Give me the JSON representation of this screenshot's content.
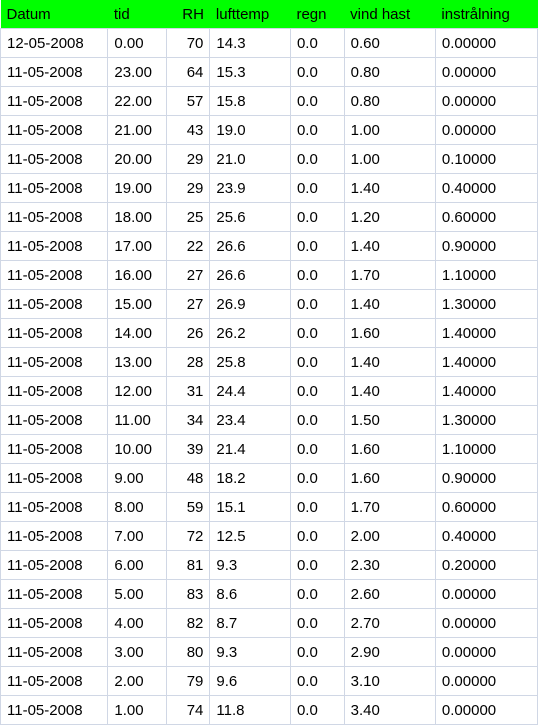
{
  "table": {
    "headers": {
      "datum": "Datum",
      "tid": "tid",
      "rh": "RH",
      "lufttemp": "lufttemp",
      "regn": "regn",
      "vindhast": "vind hast",
      "instralning": "instrålning"
    },
    "rows": [
      {
        "datum": "12-05-2008",
        "tid": "0.00",
        "rh": "70",
        "lufttemp": "14.3",
        "regn": "0.0",
        "vindhast": "0.60",
        "instralning": "0.00000"
      },
      {
        "datum": "11-05-2008",
        "tid": "23.00",
        "rh": "64",
        "lufttemp": "15.3",
        "regn": "0.0",
        "vindhast": "0.80",
        "instralning": "0.00000"
      },
      {
        "datum": "11-05-2008",
        "tid": "22.00",
        "rh": "57",
        "lufttemp": "15.8",
        "regn": "0.0",
        "vindhast": "0.80",
        "instralning": "0.00000"
      },
      {
        "datum": "11-05-2008",
        "tid": "21.00",
        "rh": "43",
        "lufttemp": "19.0",
        "regn": "0.0",
        "vindhast": "1.00",
        "instralning": "0.00000"
      },
      {
        "datum": "11-05-2008",
        "tid": "20.00",
        "rh": "29",
        "lufttemp": "21.0",
        "regn": "0.0",
        "vindhast": "1.00",
        "instralning": "0.10000"
      },
      {
        "datum": "11-05-2008",
        "tid": "19.00",
        "rh": "29",
        "lufttemp": "23.9",
        "regn": "0.0",
        "vindhast": "1.40",
        "instralning": "0.40000"
      },
      {
        "datum": "11-05-2008",
        "tid": "18.00",
        "rh": "25",
        "lufttemp": "25.6",
        "regn": "0.0",
        "vindhast": "1.20",
        "instralning": "0.60000"
      },
      {
        "datum": "11-05-2008",
        "tid": "17.00",
        "rh": "22",
        "lufttemp": "26.6",
        "regn": "0.0",
        "vindhast": "1.40",
        "instralning": "0.90000"
      },
      {
        "datum": "11-05-2008",
        "tid": "16.00",
        "rh": "27",
        "lufttemp": "26.6",
        "regn": "0.0",
        "vindhast": "1.70",
        "instralning": "1.10000"
      },
      {
        "datum": "11-05-2008",
        "tid": "15.00",
        "rh": "27",
        "lufttemp": "26.9",
        "regn": "0.0",
        "vindhast": "1.40",
        "instralning": "1.30000"
      },
      {
        "datum": "11-05-2008",
        "tid": "14.00",
        "rh": "26",
        "lufttemp": "26.2",
        "regn": "0.0",
        "vindhast": "1.60",
        "instralning": "1.40000"
      },
      {
        "datum": "11-05-2008",
        "tid": "13.00",
        "rh": "28",
        "lufttemp": "25.8",
        "regn": "0.0",
        "vindhast": "1.40",
        "instralning": "1.40000"
      },
      {
        "datum": "11-05-2008",
        "tid": "12.00",
        "rh": "31",
        "lufttemp": "24.4",
        "regn": "0.0",
        "vindhast": "1.40",
        "instralning": "1.40000"
      },
      {
        "datum": "11-05-2008",
        "tid": "11.00",
        "rh": "34",
        "lufttemp": "23.4",
        "regn": "0.0",
        "vindhast": "1.50",
        "instralning": "1.30000"
      },
      {
        "datum": "11-05-2008",
        "tid": "10.00",
        "rh": "39",
        "lufttemp": "21.4",
        "regn": "0.0",
        "vindhast": "1.60",
        "instralning": "1.10000"
      },
      {
        "datum": "11-05-2008",
        "tid": "9.00",
        "rh": "48",
        "lufttemp": "18.2",
        "regn": "0.0",
        "vindhast": "1.60",
        "instralning": "0.90000"
      },
      {
        "datum": "11-05-2008",
        "tid": "8.00",
        "rh": "59",
        "lufttemp": "15.1",
        "regn": "0.0",
        "vindhast": "1.70",
        "instralning": "0.60000"
      },
      {
        "datum": "11-05-2008",
        "tid": "7.00",
        "rh": "72",
        "lufttemp": "12.5",
        "regn": "0.0",
        "vindhast": "2.00",
        "instralning": "0.40000"
      },
      {
        "datum": "11-05-2008",
        "tid": "6.00",
        "rh": "81",
        "lufttemp": "9.3",
        "regn": "0.0",
        "vindhast": "2.30",
        "instralning": "0.20000"
      },
      {
        "datum": "11-05-2008",
        "tid": "5.00",
        "rh": "83",
        "lufttemp": "8.6",
        "regn": "0.0",
        "vindhast": "2.60",
        "instralning": "0.00000"
      },
      {
        "datum": "11-05-2008",
        "tid": "4.00",
        "rh": "82",
        "lufttemp": "8.7",
        "regn": "0.0",
        "vindhast": "2.70",
        "instralning": "0.00000"
      },
      {
        "datum": "11-05-2008",
        "tid": "3.00",
        "rh": "80",
        "lufttemp": "9.3",
        "regn": "0.0",
        "vindhast": "2.90",
        "instralning": "0.00000"
      },
      {
        "datum": "11-05-2008",
        "tid": "2.00",
        "rh": "79",
        "lufttemp": "9.6",
        "regn": "0.0",
        "vindhast": "3.10",
        "instralning": "0.00000"
      },
      {
        "datum": "11-05-2008",
        "tid": "1.00",
        "rh": "74",
        "lufttemp": "11.8",
        "regn": "0.0",
        "vindhast": "3.40",
        "instralning": "0.00000"
      }
    ]
  }
}
